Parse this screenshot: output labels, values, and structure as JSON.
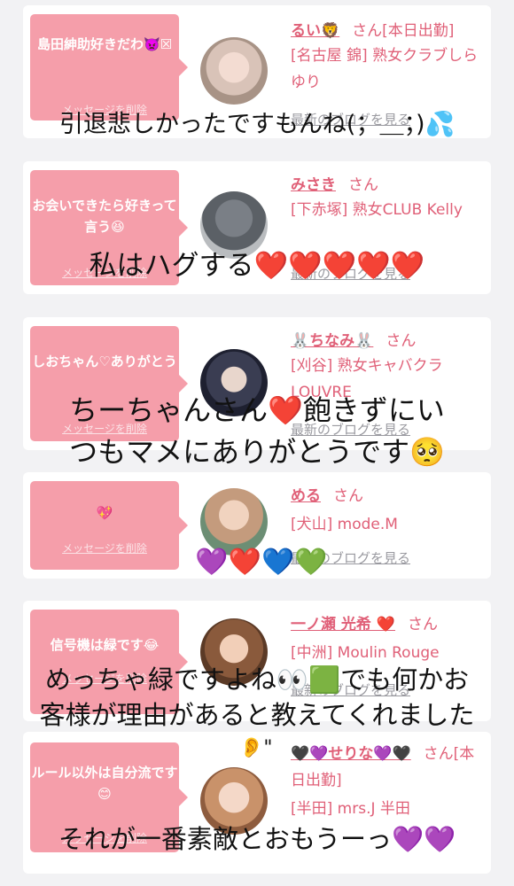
{
  "cards": [
    {
      "message": "島田紳助好きだわ👿☒",
      "delete_label": "メッセージを削除",
      "name": "るい🦁",
      "san": "さん",
      "status": "[本日出勤]",
      "shop": "[名古屋 錦] 熟女クラブしらゆり",
      "blog_label": "最新のブログを見る"
    },
    {
      "message": "お会いできたら好きって言う😆",
      "delete_label": "メッセージを削除",
      "name": "みさき",
      "san": "さん",
      "shop": "[下赤塚] 熟女CLUB Kelly",
      "blog_label": "最新のブログを見る"
    },
    {
      "message": "しおちゃん♡ありがとう",
      "delete_label": "メッセージを削除",
      "name": "🐰ちなみ🐰",
      "san": "さん",
      "shop": "[刈谷] 熟女キャバクラ LOUVRE",
      "blog_label": "最新のブログを見る"
    },
    {
      "message": "💖",
      "delete_label": "メッセージを削除",
      "name": "める",
      "san": "さん",
      "shop": "[犬山] mode.M",
      "blog_label": "最新のブログを見る"
    },
    {
      "message": "信号機は緑です😂",
      "delete_label": "メッセージを削除",
      "name": "一ノ瀬 光希 ❤️",
      "san": "さん",
      "shop": "[中洲] Moulin Rouge",
      "blog_label": "最新のブログを見る"
    },
    {
      "message": "ルール以外は自分流です😊",
      "delete_label": "メッセージを削除",
      "name": "🖤💜せりな💜🖤",
      "san": "さん",
      "status": "[本日出勤]",
      "shop": "[半田] mrs.J 半田"
    }
  ],
  "overlay": {
    "line1": "引退悲しかったですもんね(；＿；)💦",
    "line2": "私はハグする❤️❤️❤️❤️❤️",
    "line3a": "ちーちゃんさん❤️飽きずにい",
    "line3b": "つもマメにありがとうです🥺",
    "line4": "💜❤️💙💚",
    "line5a": "めっちゃ緑ですよね👀🟩でも何かお",
    "line5b": "客様が理由があると教えてくれました",
    "line5c": "👂\"",
    "line6": "それが一番素敵とおもうーっ💜💜"
  },
  "colors": {
    "bubble": "#f59eaa",
    "name": "#e06078",
    "background": "#f2f2f4"
  }
}
